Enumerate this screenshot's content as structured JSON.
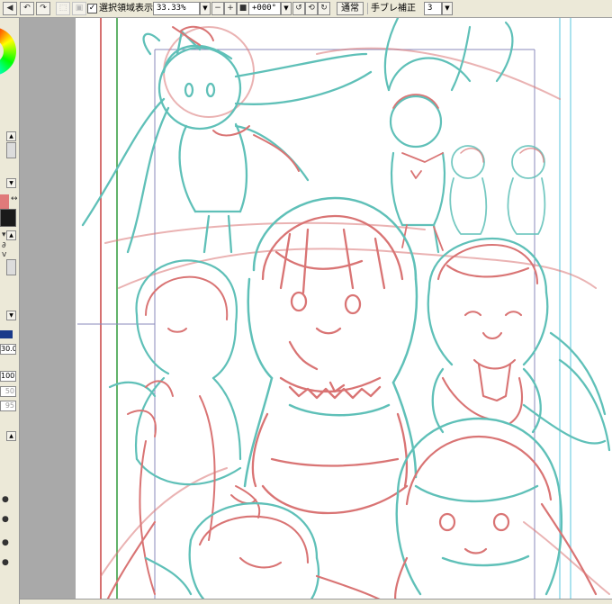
{
  "toolbar": {
    "show_selection_label": "選択領域表示",
    "show_selection_checked": "✓",
    "zoom_value": "33.33%",
    "rotation_value": "+000°",
    "blend_mode": "通常",
    "stabilizer_label": "手ブレ補正",
    "stabilizer_value": "3"
  },
  "left_panel": {
    "value_1": "30.0",
    "value_2": "100",
    "value_3": "50",
    "value_4": "95"
  },
  "colors": {
    "sketch_teal": "#5fc0b8",
    "sketch_red": "#d97474",
    "guide_cyan": "#8fd8e8",
    "guide_green": "#2e9a3a",
    "guide_red": "#c84040",
    "panel_bg": "#ece9d8",
    "canvas_bg": "#a9a9a9"
  },
  "icons": {
    "undo": "undo-icon",
    "redo": "redo-icon",
    "rotate": "rotate-icon"
  }
}
